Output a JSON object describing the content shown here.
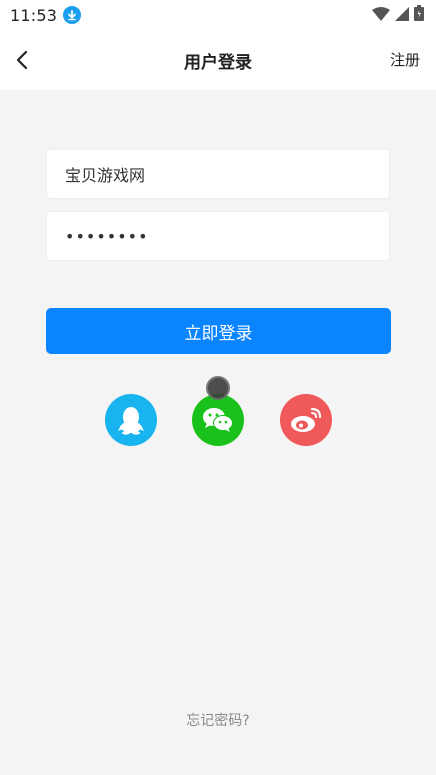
{
  "status_bar": {
    "time": "11:53",
    "icons": [
      "download-icon",
      "wifi-icon",
      "signal-icon",
      "battery-icon"
    ]
  },
  "header": {
    "title": "用户登录",
    "register_label": "注册",
    "back_icon": "chevron-left-icon"
  },
  "form": {
    "username_value": "宝贝游戏网",
    "password_value": "••••••••",
    "login_label": "立即登录"
  },
  "social_login": [
    {
      "name": "qq-icon",
      "color": "#18b4f0"
    },
    {
      "name": "wechat-icon",
      "color": "#1bc11b"
    },
    {
      "name": "weibo-icon",
      "color": "#f05959"
    }
  ],
  "forgot_password_label": "忘记密码?",
  "colors": {
    "primary": "#0a84ff",
    "background": "#f4f4f4"
  }
}
